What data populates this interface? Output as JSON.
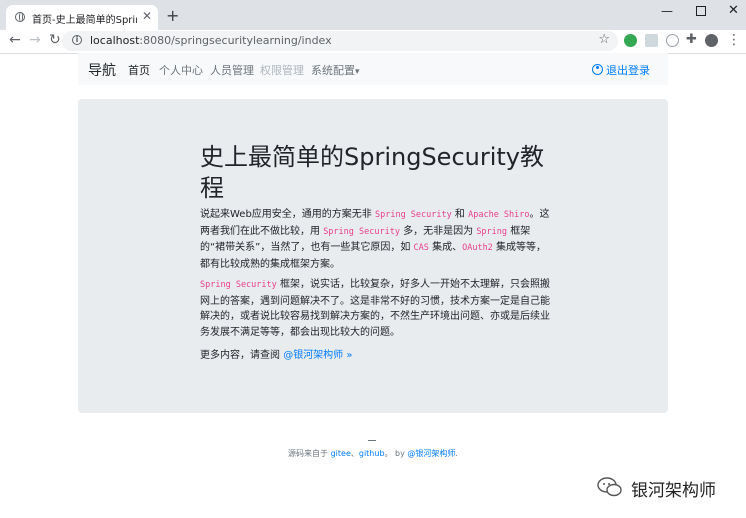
{
  "browser": {
    "tab_title": "首页-史上最简单的SpringSecurity教程",
    "url_host": "localhost",
    "url_rest": ":8080/springsecuritylearning/index"
  },
  "navbar": {
    "brand": "导航",
    "items": [
      {
        "label": "首页",
        "state": "active"
      },
      {
        "label": "个人中心",
        "state": "normal"
      },
      {
        "label": "人员管理",
        "state": "normal"
      },
      {
        "label": "权限管理",
        "state": "disabled"
      },
      {
        "label": "系统配置",
        "state": "normal"
      }
    ],
    "dropdown_caret": "▾",
    "logout_label": "退出登录"
  },
  "jumbotron": {
    "title": "史上最简单的SpringSecurity教程",
    "p1": {
      "t1": "说起来Web应用安全，通用的方案无非 ",
      "c1": "Spring Security",
      "t2": " 和 ",
      "c2": "Apache Shiro",
      "t3": "。这两者我们在此不做比较，用 ",
      "c3": "Spring Security",
      "t4": " 多，无非是因为 ",
      "c4": "Spring",
      "t5": " 框架的“裙带关系”，当然了，也有一些其它原因，如 ",
      "c5": "CAS",
      "t6": " 集成、",
      "c6": "OAuth2",
      "t7": " 集成等等，都有比较成熟的集成框架方案。"
    },
    "p2": {
      "c1": "Spring Security",
      "t1": " 框架，说实话，比较复杂，好多人一开始不太理解，只会照搬网上的答案，遇到问题解决不了。这是非常不好的习惯，技术方案一定是自己能解决的，或者说比较容易找到解决方案的，不然生产环境出问题、亦或是后续业务发展不满足等等，都会出现比较大的问题。"
    },
    "more_text": "更多内容，请查阅 ",
    "more_link": "@银河架构师 »"
  },
  "footer": {
    "prefix": "源码来自于 ",
    "link1": "gitee",
    "sep": "、",
    "link2": "github",
    "mid": "。 by ",
    "link3": "@银河架构师",
    "end": "."
  },
  "watermark": "银河架构师",
  "colors": {
    "accent": "#007bff",
    "code": "#e83e8c",
    "jumbotron_bg": "#e9ecef"
  }
}
